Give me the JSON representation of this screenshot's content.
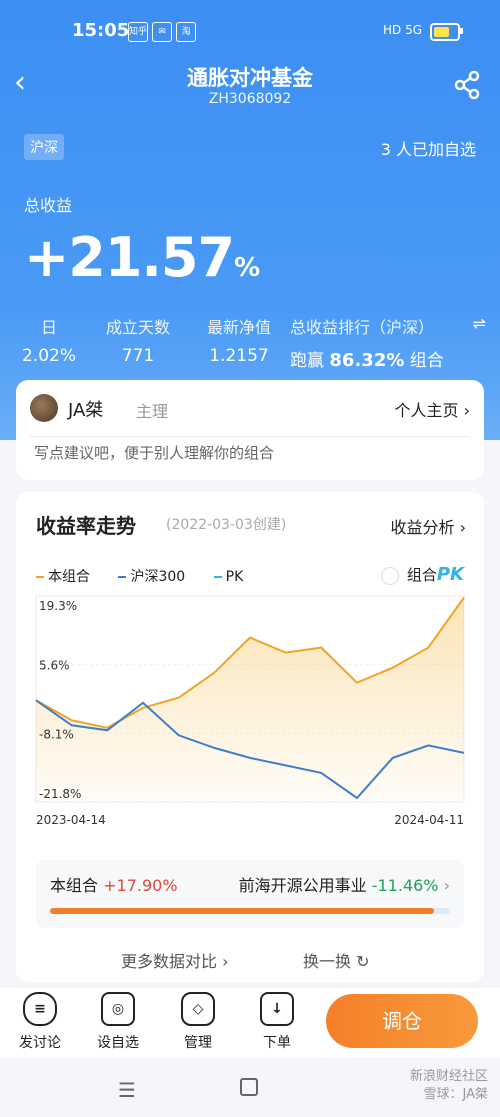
{
  "status_bar": {
    "time": "15:05",
    "app_icons": [
      "知乎",
      "✉",
      "淘"
    ],
    "indicators": "HD 5G"
  },
  "header": {
    "title": "通胀对冲基金",
    "code": "ZH3068092"
  },
  "hero": {
    "market_tag": "沪深",
    "watchers": "3 人已加自选",
    "total_label": "总收益",
    "total_value": "+21.57",
    "total_unit": "%",
    "metrics": [
      {
        "label": "日",
        "value": "2.02%"
      },
      {
        "label": "成立天数",
        "value": "771"
      },
      {
        "label": "最新净值",
        "value": "1.2157"
      }
    ],
    "rank_label": "总收益排行（沪深）",
    "rank_prefix": "跑赢",
    "rank_value": "86.32%",
    "rank_suffix": "组合"
  },
  "manager": {
    "name": "JA桀",
    "role": "主理",
    "homepage_label": "个人主页 ›",
    "note": "写点建议吧，便于别人理解你的组合"
  },
  "chart_card": {
    "title": "收益率走势",
    "created": "(2022-03-03创建)",
    "analysis_label": "收益分析 ›",
    "legend": [
      {
        "label": "本组合",
        "color": "#f0a524"
      },
      {
        "label": "沪深300",
        "color": "#3f7fc9"
      },
      {
        "label": "PK",
        "color": "#2fb3e8"
      }
    ],
    "combo_label": "组合",
    "pk_label": "PK"
  },
  "chart_data": {
    "type": "line",
    "x": [
      "2023-04-14",
      "2023-05-15",
      "2023-06-15",
      "2023-07-17",
      "2023-08-15",
      "2023-09-15",
      "2023-10-17",
      "2023-11-15",
      "2023-12-15",
      "2024-01-15",
      "2024-02-19",
      "2024-03-15",
      "2024-04-11"
    ],
    "series": [
      {
        "name": "本组合",
        "color": "#f0a524",
        "values": [
          -1.5,
          -5.5,
          -7.0,
          -3.0,
          -1.0,
          4.0,
          11.0,
          8.0,
          9.0,
          2.0,
          5.0,
          9.0,
          19.0
        ]
      },
      {
        "name": "沪深300",
        "color": "#3f7fc9",
        "values": [
          -1.5,
          -6.5,
          -7.5,
          -2.0,
          -8.5,
          -11.0,
          -13.0,
          -14.5,
          -16.0,
          -21.0,
          -13.0,
          -10.5,
          -12.0
        ]
      }
    ],
    "yticks": [
      "19.3%",
      "5.6%",
      "-8.1%",
      "-21.8%"
    ],
    "ylim": [
      -21.8,
      19.3
    ],
    "xticks": [
      "2023-04-14",
      "2024-04-11"
    ]
  },
  "comparison": {
    "left_label": "本组合",
    "left_value": "+17.90%",
    "right_label": "前海开源公用事业",
    "right_value": "-11.46%",
    "arrow": "›",
    "progress": 0.96
  },
  "more_compare": "更多数据对比 ›",
  "shuffle": "换一换 ↻",
  "bottom_tabs": [
    {
      "label": "发讨论",
      "icon": "chat-icon",
      "glyph": "≡"
    },
    {
      "label": "设自选",
      "icon": "watchlist-icon",
      "glyph": "◎"
    },
    {
      "label": "管理",
      "icon": "manage-icon",
      "glyph": "◇"
    },
    {
      "label": "下单",
      "icon": "order-icon",
      "glyph": "↓"
    }
  ],
  "adjust_button": "调仓",
  "watermark": {
    "line1": "新浪财经社区",
    "line2": "雪球：JA桀"
  }
}
